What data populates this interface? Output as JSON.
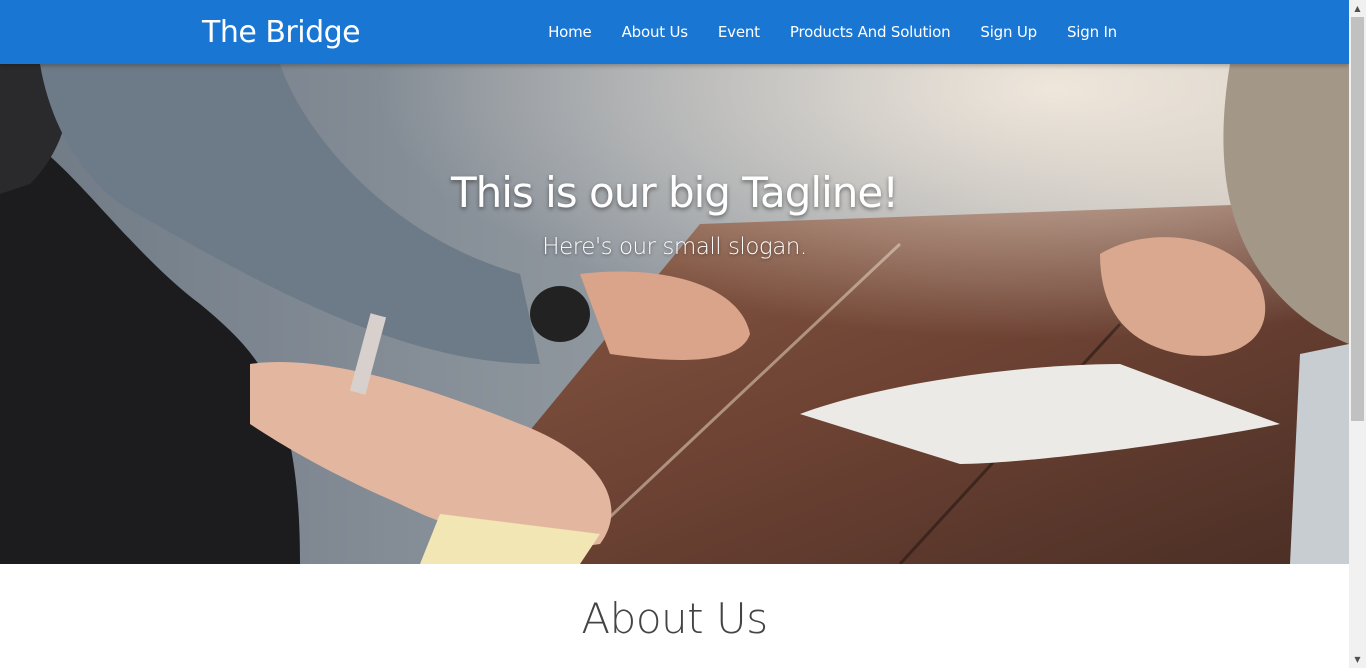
{
  "navbar": {
    "brand": "The Bridge",
    "links": [
      "Home",
      "About Us",
      "Event",
      "Products And Solution",
      "Sign Up",
      "Sign In"
    ],
    "background_color": "#1976d2"
  },
  "hero": {
    "tagline": "This is our big Tagline!",
    "slogan": "Here's our small slogan."
  },
  "about": {
    "heading": "About Us"
  },
  "scrollbar": {
    "up_icon": "triangle-up-icon",
    "down_icon": "triangle-down-icon"
  }
}
